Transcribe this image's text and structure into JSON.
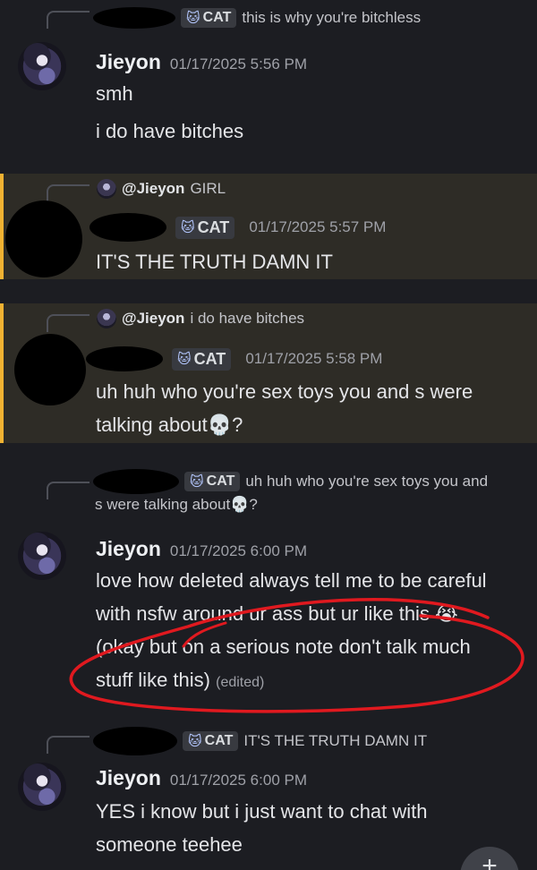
{
  "messages": [
    {
      "reply_tag": "CAT",
      "reply_text": "this is why you're bitchless",
      "author": "Jieyon",
      "timestamp": "01/17/2025 5:56 PM",
      "lines": [
        "smh",
        "i do have bitches"
      ]
    },
    {
      "reply_mention": "@Jieyon",
      "reply_text": "GIRL",
      "tag": "CAT",
      "timestamp": "01/17/2025 5:57 PM",
      "text": "IT'S THE TRUTH DAMN IT"
    },
    {
      "reply_mention": "@Jieyon",
      "reply_text": "i do have bitches",
      "tag": "CAT",
      "timestamp": "01/17/2025 5:58 PM",
      "text": "uh huh who you're sex toys you and s were talking about💀?"
    },
    {
      "reply_tag": "CAT",
      "reply_text_line1": "uh huh who you're sex toys you and",
      "reply_text_line2": "s were talking about💀?",
      "author": "Jieyon",
      "timestamp": "01/17/2025 6:00 PM",
      "text": "love how deleted always tell me to be careful with nsfw around ur ass but ur like this 😭 (okay but on a serious note don't talk much stuff like this)",
      "edited": "(edited)"
    },
    {
      "reply_tag": "CAT",
      "reply_text": "IT'S THE TRUTH DAMN IT",
      "author": "Jieyon",
      "timestamp": "01/17/2025 6:00 PM",
      "text": "YES i know but i just want to chat with someone teehee"
    }
  ],
  "fab_label": "+",
  "colors": {
    "background": "#1c1d22",
    "highlight": "#2e2c26",
    "highlight_bar": "#f0b232",
    "annotation": "#e0191f"
  },
  "icons": [
    "cat-icon",
    "plus-icon"
  ]
}
